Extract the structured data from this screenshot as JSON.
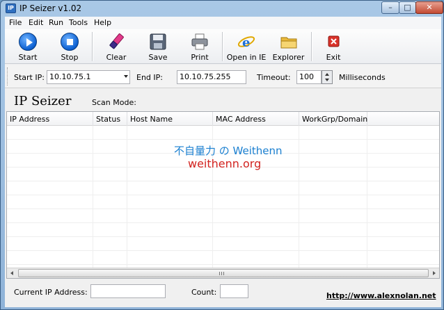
{
  "window": {
    "title": "IP Seizer v1.02",
    "min_glyph": "–",
    "max_glyph": "□",
    "close_glyph": "✕",
    "icon_text": "IP"
  },
  "menu": [
    {
      "label": "File"
    },
    {
      "label": "Edit"
    },
    {
      "label": "Run"
    },
    {
      "label": "Tools"
    },
    {
      "label": "Help"
    }
  ],
  "toolbar": {
    "start": "Start",
    "stop": "Stop",
    "clear": "Clear",
    "save": "Save",
    "print": "Print",
    "open_ie": "Open in IE",
    "explorer": "Explorer",
    "exit": "Exit"
  },
  "params": {
    "start_ip_label": "Start IP:",
    "start_ip_value": "10.10.75.1",
    "end_ip_label": "End IP:",
    "end_ip_value": "10.10.75.255",
    "timeout_label": "Timeout:",
    "timeout_value": "100",
    "timeout_unit": "Milliseconds"
  },
  "header": {
    "app_name": "IP Seizer",
    "scan_mode_label": "Scan Mode:"
  },
  "list": {
    "columns": [
      "IP Address",
      "Status",
      "Host Name",
      "MAC Address",
      "WorkGrp/Domain"
    ],
    "watermark_line1": "不自量力 の Weithenn",
    "watermark_line2": "weithenn.org"
  },
  "status": {
    "current_ip_label": "Current IP Address:",
    "current_ip_value": "",
    "count_label": "Count:",
    "count_value": "",
    "link": "http://www.alexnolan.net"
  },
  "colors": {
    "accent_blue": "#0b5fd1",
    "watermark_blue": "#1a7fd0",
    "watermark_red": "#d2231f",
    "exit_red": "#d9322a"
  }
}
